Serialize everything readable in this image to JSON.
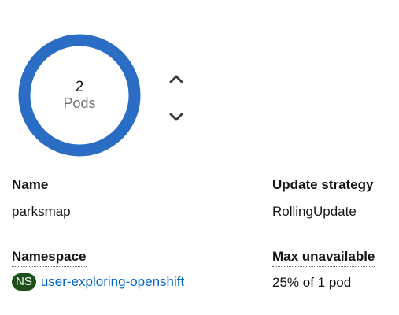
{
  "pods": {
    "count": "2",
    "unit": "Pods",
    "ring_color": "#2b6cc4"
  },
  "scale": {
    "up_icon": "chevron-up-icon",
    "down_icon": "chevron-down-icon"
  },
  "details": {
    "name": {
      "label": "Name",
      "value": "parksmap"
    },
    "namespace": {
      "label": "Namespace",
      "badge": "NS",
      "value": "user-exploring-openshift",
      "badge_color": "#1e4f18",
      "link_color": "#0066cc"
    },
    "update_strategy": {
      "label": "Update strategy",
      "value": "RollingUpdate"
    },
    "max_unavailable": {
      "label": "Max unavailable",
      "value": "25% of 1 pod"
    }
  }
}
